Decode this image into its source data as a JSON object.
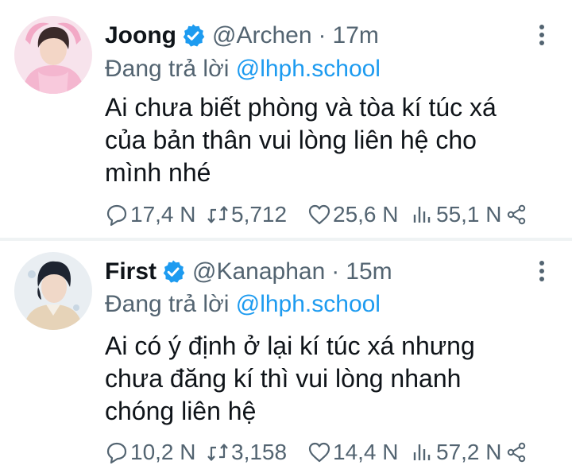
{
  "tweets": [
    {
      "display_name": "Joong",
      "handle": "@Archen",
      "separator": "·",
      "time": "17m",
      "reply_prefix": "Đang trả lời",
      "reply_to": "@lhph.school",
      "text_lines": [
        "Ai chưa biết phòng và tòa kí túc xá",
        "của bản thân vui lòng liên hệ cho",
        "mình nhé"
      ],
      "stats": {
        "replies": "17,4 N",
        "retweets": "5,712",
        "likes": "25,6 N",
        "views": "55,1 N"
      }
    },
    {
      "display_name": "First",
      "handle": "@Kanaphan",
      "separator": "·",
      "time": "15m",
      "reply_prefix": "Đang trả lời",
      "reply_to": "@lhph.school",
      "text_lines": [
        "Ai có ý định ở lại kí túc xá nhưng",
        "chưa đăng kí thì vui lòng nhanh",
        "chóng liên hệ"
      ],
      "stats": {
        "replies": "10,2 N",
        "retweets": "3,158",
        "likes": "14,4 N",
        "views": "57,2 N"
      }
    }
  ],
  "colors": {
    "text": "#0f1419",
    "secondary": "#536471",
    "accent": "#1d9bf0",
    "divider": "#eff3f4"
  },
  "icons": {
    "verified": "verified-badge-icon",
    "more": "more-vertical-icon",
    "reply": "reply-icon",
    "retweet": "retweet-icon",
    "like": "heart-icon",
    "views": "views-icon",
    "share": "share-icon"
  }
}
